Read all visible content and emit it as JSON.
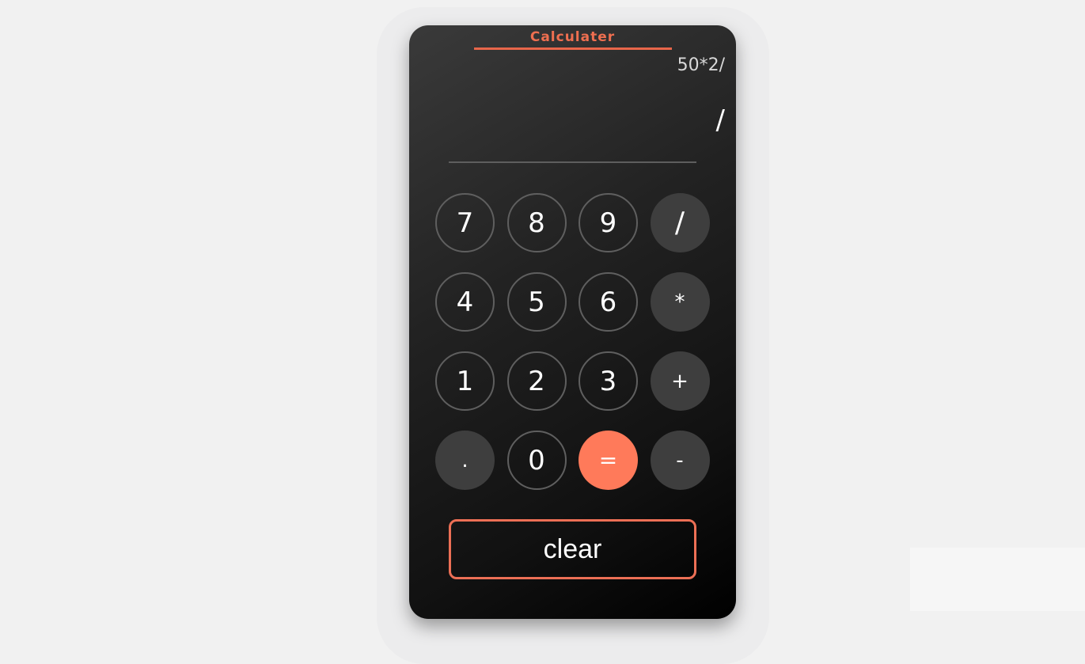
{
  "app": {
    "title": "Calculater"
  },
  "display": {
    "history": "50*2/",
    "current": "/"
  },
  "keypad": {
    "keys": [
      {
        "label": "7",
        "kind": "num",
        "name": "key-7"
      },
      {
        "label": "8",
        "kind": "num",
        "name": "key-8"
      },
      {
        "label": "9",
        "kind": "num",
        "name": "key-9"
      },
      {
        "label": "/",
        "kind": "op",
        "name": "key-divide"
      },
      {
        "label": "4",
        "kind": "num",
        "name": "key-4"
      },
      {
        "label": "5",
        "kind": "num",
        "name": "key-5"
      },
      {
        "label": "6",
        "kind": "num",
        "name": "key-6"
      },
      {
        "label": "*",
        "kind": "op",
        "name": "key-multiply"
      },
      {
        "label": "1",
        "kind": "num",
        "name": "key-1"
      },
      {
        "label": "2",
        "kind": "num",
        "name": "key-2"
      },
      {
        "label": "3",
        "kind": "num",
        "name": "key-3"
      },
      {
        "label": "+",
        "kind": "op",
        "name": "key-add"
      },
      {
        "label": ".",
        "kind": "op",
        "name": "key-decimal"
      },
      {
        "label": "0",
        "kind": "num",
        "name": "key-0"
      },
      {
        "label": "=",
        "kind": "eq",
        "name": "key-equals"
      },
      {
        "label": "-",
        "kind": "op",
        "name": "key-subtract"
      }
    ]
  },
  "actions": {
    "clear_label": "clear"
  },
  "colors": {
    "accent": "#ef6f50",
    "equals": "#ff7a5a",
    "operator_bg": "#3e3e3e",
    "number_border": "#5f5f5f",
    "page_bg": "#f1f1f1"
  }
}
